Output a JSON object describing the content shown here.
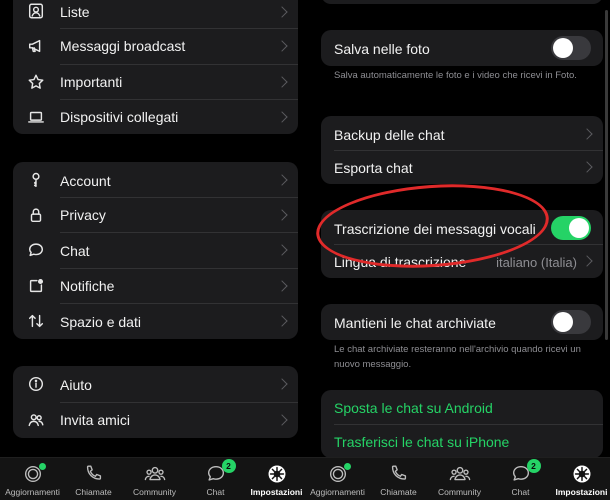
{
  "colors": {
    "accent": "#25d366",
    "background": "#000000",
    "group": "#1c1c1e",
    "annotation": "#e02a2a"
  },
  "left": {
    "group1": [
      {
        "label": "Liste",
        "icon": "contact-card-icon"
      },
      {
        "label": "Messaggi broadcast",
        "icon": "megaphone-icon"
      },
      {
        "label": "Importanti",
        "icon": "star-icon"
      },
      {
        "label": "Dispositivi collegati",
        "icon": "laptop-icon"
      }
    ],
    "group2": [
      {
        "label": "Account",
        "icon": "key-icon"
      },
      {
        "label": "Privacy",
        "icon": "lock-icon"
      },
      {
        "label": "Chat",
        "icon": "chat-bubble-icon"
      },
      {
        "label": "Notifiche",
        "icon": "notification-icon"
      },
      {
        "label": "Spazio e dati",
        "icon": "data-arrows-icon"
      }
    ],
    "group3": [
      {
        "label": "Aiuto",
        "icon": "info-icon"
      },
      {
        "label": "Invita amici",
        "icon": "people-icon"
      }
    ]
  },
  "right": {
    "save_photos": {
      "label": "Salva nelle foto",
      "on": false
    },
    "save_photos_note": "Salva automaticamente le foto e i video che ricevi in Foto.",
    "backup": "Backup delle chat",
    "export": "Esporta chat",
    "transcription": {
      "label": "Trascrizione dei messaggi vocali",
      "on": true
    },
    "transcription_lang": {
      "label": "Lingua di trascrizione",
      "value": "italiano (Italia)"
    },
    "keep_archived": {
      "label": "Mantieni le chat archiviate",
      "on": false
    },
    "keep_archived_note": "Le chat archiviate resteranno nell'archivio quando ricevi un nuovo messaggio.",
    "move_android": "Sposta le chat su Android",
    "transfer_iphone": "Trasferisci le chat su iPhone"
  },
  "tabs": [
    {
      "label": "Aggiornamenti",
      "icon": "updates-icon",
      "active": false
    },
    {
      "label": "Chiamate",
      "icon": "phone-icon",
      "active": false
    },
    {
      "label": "Community",
      "icon": "community-icon",
      "active": false
    },
    {
      "label": "Chat",
      "icon": "chats-icon",
      "badge": "2",
      "active": false
    },
    {
      "label": "Impostazioni",
      "icon": "settings-icon",
      "active": true
    }
  ]
}
